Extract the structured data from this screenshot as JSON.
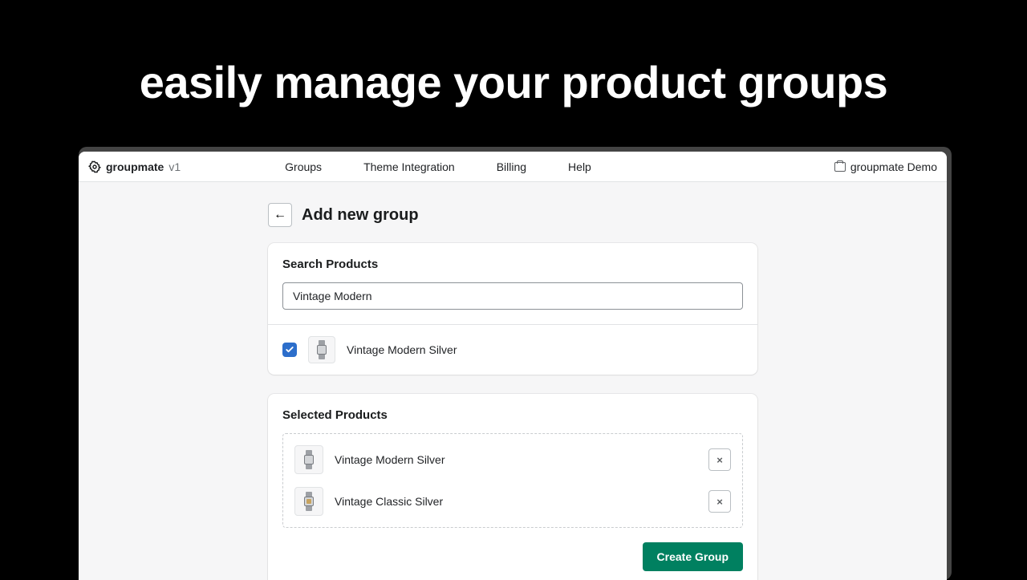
{
  "marketing": {
    "tagline": "easily manage your product groups"
  },
  "brand": {
    "name": "groupmate",
    "version": "v1"
  },
  "nav": {
    "items": [
      "Groups",
      "Theme Integration",
      "Billing",
      "Help"
    ]
  },
  "store_chip": {
    "label": "groupmate Demo"
  },
  "page": {
    "back_icon": "←",
    "title": "Add new group"
  },
  "search": {
    "label": "Search Products",
    "value": "Vintage Modern"
  },
  "search_results": [
    {
      "name": "Vintage Modern Silver",
      "checked": true
    }
  ],
  "selected": {
    "label": "Selected Products",
    "items": [
      {
        "name": "Vintage Modern Silver",
        "variant": "silver"
      },
      {
        "name": "Vintage Classic Silver",
        "variant": "gold"
      }
    ]
  },
  "actions": {
    "create_label": "Create Group",
    "remove_glyph": "×"
  }
}
